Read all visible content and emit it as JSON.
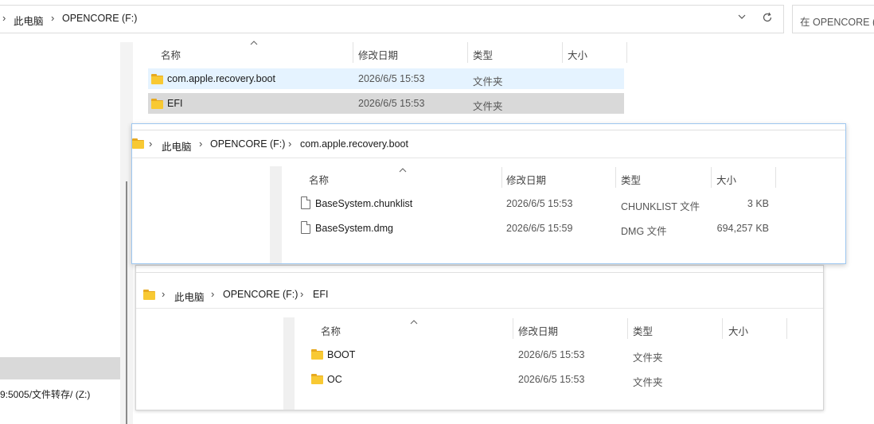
{
  "main": {
    "breadcrumb": [
      "此电脑",
      "OPENCORE (F:)"
    ],
    "search_placeholder": "在 OPENCORE (F:) 中搜索",
    "columns": {
      "name": "名称",
      "date": "修改日期",
      "type": "类型",
      "size": "大小"
    },
    "rows": [
      {
        "name": "com.apple.recovery.boot",
        "date": "2026/6/5 15:53",
        "type": "文件夹",
        "size": ""
      },
      {
        "name": "EFI",
        "date": "2026/6/5 15:53",
        "type": "文件夹",
        "size": ""
      }
    ]
  },
  "sidebar": {
    "drive_label": "9:5005/文件转存/ (Z:)"
  },
  "recovery_window": {
    "breadcrumb": [
      "此电脑",
      "OPENCORE (F:)",
      "com.apple.recovery.boot"
    ],
    "columns": {
      "name": "名称",
      "date": "修改日期",
      "type": "类型",
      "size": "大小"
    },
    "rows": [
      {
        "name": "BaseSystem.chunklist",
        "date": "2026/6/5 15:53",
        "type": "CHUNKLIST 文件",
        "size": "3 KB"
      },
      {
        "name": "BaseSystem.dmg",
        "date": "2026/6/5 15:59",
        "type": "DMG 文件",
        "size": "694,257 KB"
      }
    ]
  },
  "efi_window": {
    "breadcrumb": [
      "此电脑",
      "OPENCORE (F:)",
      "EFI"
    ],
    "columns": {
      "name": "名称",
      "date": "修改日期",
      "type": "类型",
      "size": "大小"
    },
    "rows": [
      {
        "name": "BOOT",
        "date": "2026/6/5 15:53",
        "type": "文件夹",
        "size": ""
      },
      {
        "name": "OC",
        "date": "2026/6/5 15:53",
        "type": "文件夹",
        "size": ""
      }
    ]
  },
  "colors": {
    "accent_border": "#9ec7f0",
    "selected_row": "#e5f3ff",
    "hover_row": "#d9d9d9"
  },
  "icons": {
    "folder": "folder-icon",
    "file": "file-icon",
    "refresh": "refresh-icon",
    "dropdown": "chevron-down-icon"
  }
}
